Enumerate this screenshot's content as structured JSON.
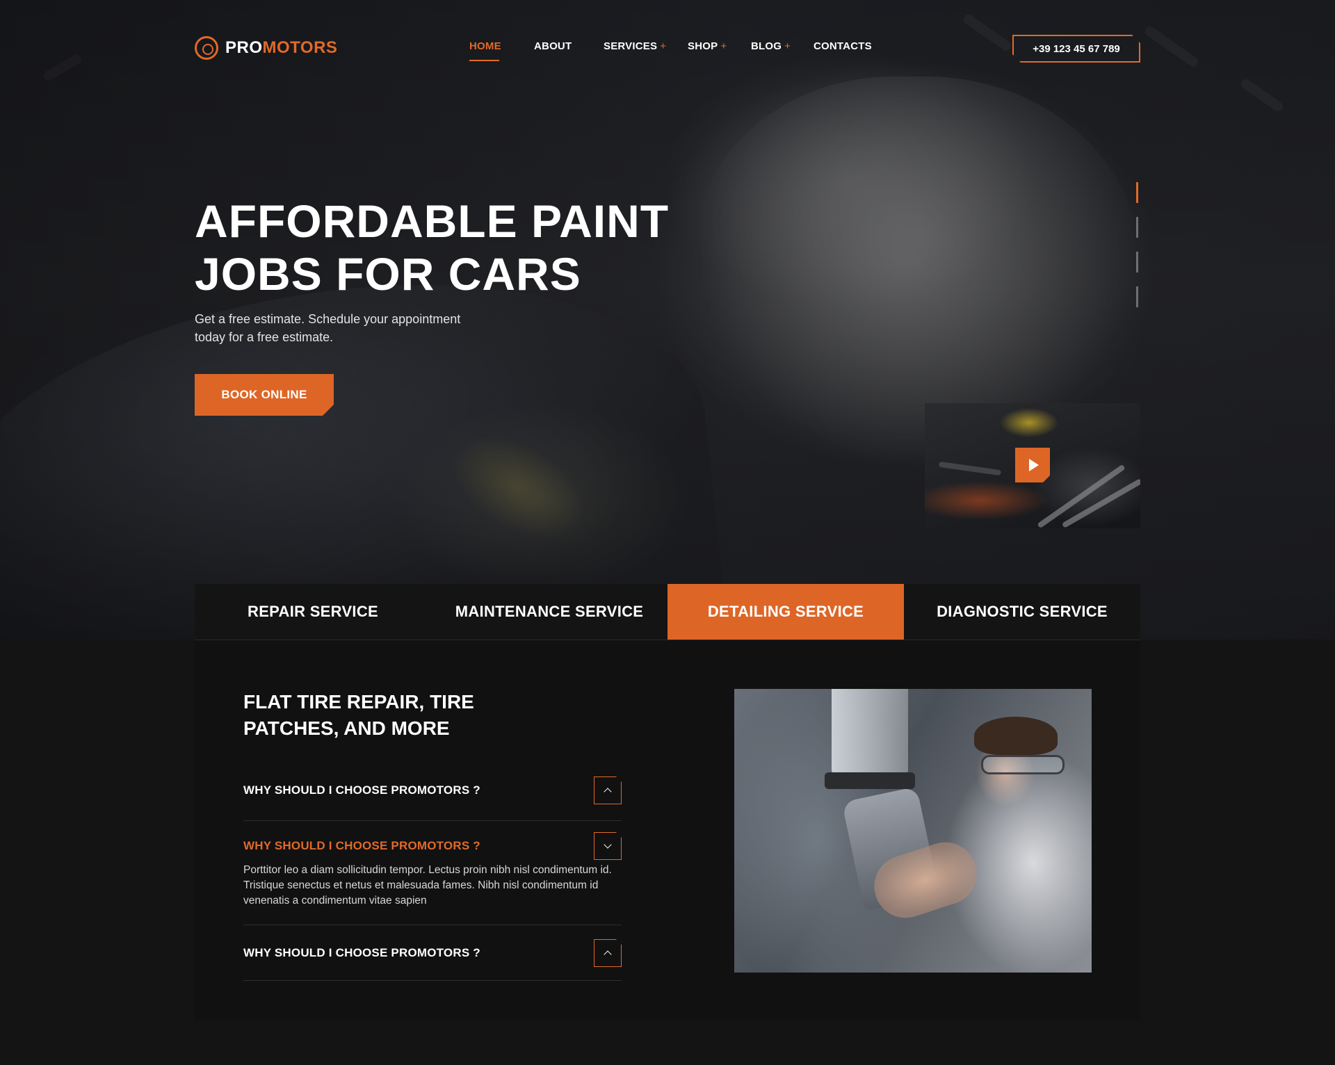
{
  "brand": {
    "pro": "PRO",
    "motors": "MOTORS"
  },
  "nav": {
    "items": [
      {
        "label": "HOME",
        "plus": ""
      },
      {
        "label": "ABOUT",
        "plus": ""
      },
      {
        "label": "SERVICES",
        "plus": "+"
      },
      {
        "label": "SHOP",
        "plus": "+"
      },
      {
        "label": "BLOG",
        "plus": "+"
      },
      {
        "label": "CONTACTS",
        "plus": ""
      }
    ],
    "active": "HOME"
  },
  "phone": "+39 123 45 67 789",
  "hero": {
    "title_line1": "AFFORDABLE PAINT",
    "title_line2": "JOBS FOR CARS",
    "subtitle": "Get a free estimate. Schedule your appointment today for a free estimate.",
    "cta": "BOOK ONLINE",
    "slides_total": 4,
    "slide_active": 1
  },
  "tabs": {
    "items": [
      "REPAIR SERVICE",
      "MAINTENANCE SERVICE",
      "DETAILING SERVICE",
      "DIAGNOSTIC SERVICE"
    ],
    "active": "DETAILING SERVICE"
  },
  "panel": {
    "title": "FLAT TIRE REPAIR, TIRE PATCHES, AND MORE",
    "faq": [
      {
        "question": "WHY SHOULD I CHOOSE PROMOTORS ?",
        "answer": "",
        "open": false
      },
      {
        "question": "WHY SHOULD I CHOOSE PROMOTORS ?",
        "answer": "Porttitor leo a diam sollicitudin tempor. Lectus proin nibh nisl condimentum id. Tristique senectus et netus et malesuada fames. Nibh nisl condimentum id venenatis a condimentum vitae sapien",
        "open": true
      },
      {
        "question": "WHY SHOULD I CHOOSE PROMOTORS ?",
        "answer": "",
        "open": false
      }
    ]
  },
  "colors": {
    "accent": "#dd6627",
    "background": "#141414",
    "panel": "#111111"
  },
  "icons": {
    "logo": "wheel-icon",
    "video": "play-icon",
    "faq_open": "chevron-down-icon",
    "faq_closed": "chevron-up-icon"
  }
}
